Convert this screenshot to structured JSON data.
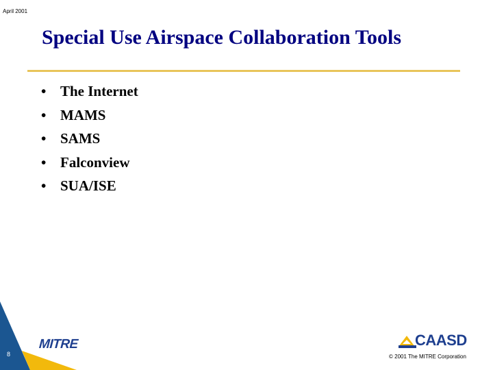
{
  "header": {
    "date": "April 2001"
  },
  "slide": {
    "title": "Special Use Airspace Collaboration Tools",
    "bullet_glyph": "•",
    "bullets": [
      "The Internet",
      "MAMS",
      "SAMS",
      "Falconview",
      "SUA/ISE"
    ]
  },
  "footer": {
    "page_number": "8",
    "left_logo": "MITRE",
    "right_logo": "CAASD",
    "copyright": "© 2001 The MITRE Corporation"
  },
  "colors": {
    "title": "#000080",
    "rule": "#e8c45a",
    "corner_blue": "#1b5691",
    "corner_yellow": "#f2b90c",
    "logo_blue": "#1e3f8f"
  }
}
